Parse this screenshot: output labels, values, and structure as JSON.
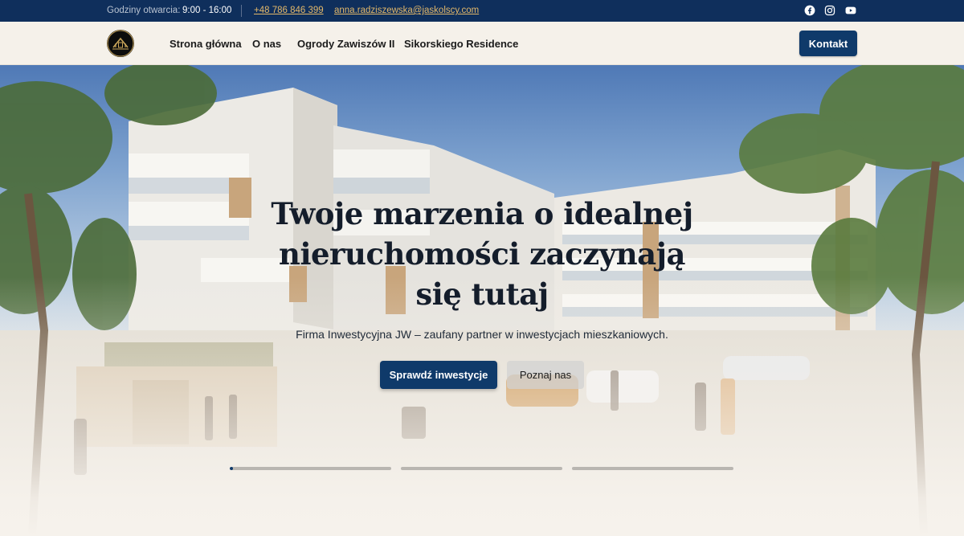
{
  "topbar": {
    "hours_label": "Godziny otwarcia:",
    "hours_value": "9:00 - 16:00",
    "phone": "+48 786 846 399",
    "email": "anna.radziszewska@jaskolscy.com",
    "social": [
      "facebook-icon",
      "instagram-icon",
      "youtube-icon"
    ]
  },
  "nav": {
    "links": [
      "Strona główna",
      "O nas",
      "Ogrody Zawiszów II",
      "Sikorskiego Residence"
    ],
    "contact": "Kontakt"
  },
  "hero": {
    "title_line1": "Twoje marzenia o idealnej",
    "title_line2": "nieruchomości zaczynają",
    "title_line3": "się tutaj",
    "subtitle": "Firma Inwestycyjna JW – zaufany partner w inwestycjach mieszkaniowych.",
    "primary_button": "Sprawdź inwestycje",
    "secondary_button": "Poznaj nas",
    "slides": [
      {
        "active": true,
        "progress": 0.02
      },
      {
        "active": false,
        "progress": 0
      },
      {
        "active": false,
        "progress": 0
      }
    ]
  },
  "colors": {
    "navy": "#0f2f5c",
    "button_navy": "#0f3a6a",
    "link_gold": "#e3b86a",
    "page_bg": "#f6f2ec"
  }
}
